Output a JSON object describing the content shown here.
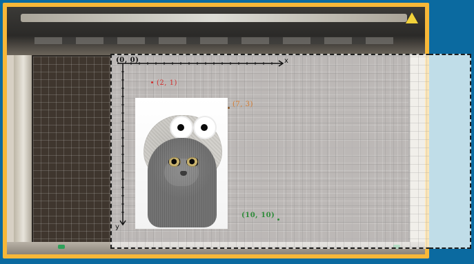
{
  "overlay": {
    "coords": {
      "origin": "(0, 0)",
      "p21": "(2, 1)",
      "p73": "(7, 3)",
      "p1010": "(10, 10)"
    },
    "axis": {
      "x_label": "x",
      "y_label": "y"
    },
    "colors": {
      "frame": "#f7b738",
      "p21": "#d22d2d",
      "p73": "#d67a2c",
      "p1010": "#2f8b3a"
    }
  }
}
